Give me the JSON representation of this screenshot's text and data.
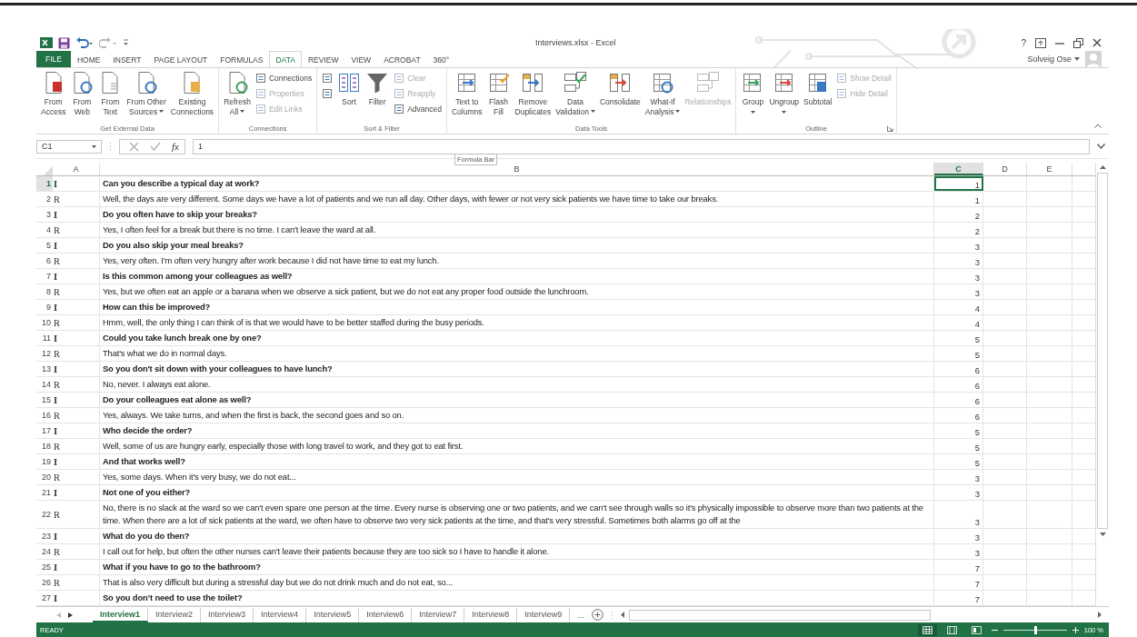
{
  "window": {
    "title": "Interviews.xlsx - Excel",
    "help": "?",
    "user": "Solveig Ose"
  },
  "tabs": [
    {
      "label": "FILE",
      "kind": "file",
      "selected": false
    },
    {
      "label": "HOME",
      "kind": "tab",
      "selected": false
    },
    {
      "label": "INSERT",
      "kind": "tab",
      "selected": false
    },
    {
      "label": "PAGE LAYOUT",
      "kind": "tab",
      "selected": false
    },
    {
      "label": "FORMULAS",
      "kind": "tab",
      "selected": false
    },
    {
      "label": "DATA",
      "kind": "tab",
      "selected": true
    },
    {
      "label": "REVIEW",
      "kind": "tab",
      "selected": false
    },
    {
      "label": "VIEW",
      "kind": "tab",
      "selected": false
    },
    {
      "label": "ACROBAT",
      "kind": "tab",
      "selected": false
    },
    {
      "label": "360°",
      "kind": "tab",
      "selected": false
    }
  ],
  "ribbon": {
    "groups": [
      {
        "label": "Get External Data",
        "items": [
          {
            "kind": "large",
            "lines": [
              "From",
              "Access"
            ],
            "disabled": false
          },
          {
            "kind": "large",
            "lines": [
              "From",
              "Web"
            ],
            "disabled": false
          },
          {
            "kind": "large",
            "lines": [
              "From",
              "Text"
            ],
            "disabled": false
          },
          {
            "kind": "large",
            "lines": [
              "From Other",
              "Sources"
            ],
            "dropdown": true,
            "disabled": false
          },
          {
            "kind": "large",
            "lines": [
              "Existing",
              "Connections"
            ],
            "disabled": false
          }
        ]
      },
      {
        "label": "Connections",
        "items": [
          {
            "kind": "large",
            "lines": [
              "Refresh",
              "All"
            ],
            "dropdown": true,
            "disabled": false
          },
          {
            "kind": "stack",
            "entries": [
              {
                "label": "Connections",
                "disabled": false
              },
              {
                "label": "Properties",
                "disabled": true
              },
              {
                "label": "Edit Links",
                "disabled": true
              }
            ]
          }
        ]
      },
      {
        "label": "Sort & Filter",
        "items": [
          {
            "kind": "stack",
            "entries": [
              {
                "disabled": false
              },
              {
                "disabled": false
              }
            ]
          },
          {
            "kind": "large",
            "lines": [
              "Sort"
            ],
            "disabled": false
          },
          {
            "kind": "large",
            "lines": [
              "Filter"
            ],
            "disabled": false
          },
          {
            "kind": "stack",
            "entries": [
              {
                "label": "Clear",
                "disabled": true
              },
              {
                "label": "Reapply",
                "disabled": true
              },
              {
                "label": "Advanced",
                "disabled": false
              }
            ]
          }
        ]
      },
      {
        "label": "Data Tools",
        "items": [
          {
            "kind": "large",
            "lines": [
              "Text to",
              "Columns"
            ],
            "disabled": false
          },
          {
            "kind": "large",
            "lines": [
              "Flash",
              "Fill"
            ],
            "disabled": false
          },
          {
            "kind": "large",
            "lines": [
              "Remove",
              "Duplicates"
            ],
            "disabled": false
          },
          {
            "kind": "large",
            "lines": [
              "Data",
              "Validation"
            ],
            "dropdown": true,
            "disabled": false
          },
          {
            "kind": "large",
            "lines": [
              "Consolidate"
            ],
            "disabled": false
          },
          {
            "kind": "large",
            "lines": [
              "What-If",
              "Analysis"
            ],
            "dropdown": true,
            "disabled": false
          },
          {
            "kind": "large",
            "lines": [
              "Relationships"
            ],
            "disabled": true
          }
        ]
      },
      {
        "label": "Outline",
        "launcher": true,
        "items": [
          {
            "kind": "large",
            "lines": [
              "Group"
            ],
            "dropdown": true,
            "caret_below": true,
            "disabled": false
          },
          {
            "kind": "large",
            "lines": [
              "Ungroup"
            ],
            "dropdown": true,
            "caret_below": true,
            "disabled": false
          },
          {
            "kind": "large",
            "lines": [
              "Subtotal"
            ],
            "disabled": false
          },
          {
            "kind": "stack",
            "entries": [
              {
                "label": "Show Detail",
                "disabled": true
              },
              {
                "label": "Hide Detail",
                "disabled": true
              }
            ]
          }
        ]
      }
    ]
  },
  "formula_bar": {
    "name_box": "C1",
    "fx": "fx",
    "value": "1",
    "tooltip": "Formula Bar"
  },
  "columns": [
    {
      "label": "A",
      "selected": false
    },
    {
      "label": "B",
      "selected": false
    },
    {
      "label": "C",
      "selected": true
    },
    {
      "label": "D",
      "selected": false
    },
    {
      "label": "E",
      "selected": false
    }
  ],
  "rows": [
    {
      "number": "1",
      "speaker": "I",
      "kind": "question",
      "text": "Can you describe a typical day at work?",
      "value": "1",
      "selected": true
    },
    {
      "number": "2",
      "speaker": "R",
      "kind": "answer",
      "text": "Well, the days are very different. Some days we have a lot of patients and we run all day. Other days, with fewer or not very sick patients we have time to take our breaks.",
      "value": "1",
      "selected": false
    },
    {
      "number": "3",
      "speaker": "I",
      "kind": "question",
      "text": "Do you often have to skip your breaks?",
      "value": "2",
      "selected": false
    },
    {
      "number": "4",
      "speaker": "R",
      "kind": "answer",
      "text": "Yes, I often feel for a break but there is no time. I can't leave the ward at all.",
      "value": "2",
      "selected": false
    },
    {
      "number": "5",
      "speaker": "I",
      "kind": "question",
      "text": "Do you also skip your meal breaks?",
      "value": "3",
      "selected": false
    },
    {
      "number": "6",
      "speaker": "R",
      "kind": "answer",
      "text": "Yes, very often. I'm often very hungry after work because I did not have time to eat my lunch.",
      "value": "3",
      "selected": false
    },
    {
      "number": "7",
      "speaker": "I",
      "kind": "question",
      "text": "Is this common among your colleagues as well?",
      "value": "3",
      "selected": false
    },
    {
      "number": "8",
      "speaker": "R",
      "kind": "answer",
      "text": "Yes, but we often eat an apple or a banana when we observe a sick patient, but we do not eat any proper food outside the lunchroom.",
      "value": "3",
      "selected": false
    },
    {
      "number": "9",
      "speaker": "I",
      "kind": "question",
      "text": "How can this be improved?",
      "value": "4",
      "selected": false
    },
    {
      "number": "10",
      "speaker": "R",
      "kind": "answer",
      "text": "Hmm, well, the only thing I can think of is that we would have to be better staffed during the busy periods.",
      "value": "4",
      "selected": false
    },
    {
      "number": "11",
      "speaker": "I",
      "kind": "question",
      "text": "Could you take lunch break one by one?",
      "value": "5",
      "selected": false
    },
    {
      "number": "12",
      "speaker": "R",
      "kind": "answer",
      "text": "That's what we do in normal days.",
      "value": "5",
      "selected": false
    },
    {
      "number": "13",
      "speaker": "I",
      "kind": "question",
      "text": "So you don't sit down with your colleagues to have lunch?",
      "value": "6",
      "selected": false
    },
    {
      "number": "14",
      "speaker": "R",
      "kind": "answer",
      "text": "No, never. I always eat alone.",
      "value": "6",
      "selected": false
    },
    {
      "number": "15",
      "speaker": "I",
      "kind": "question",
      "text": "Do your colleagues eat alone as well?",
      "value": "6",
      "selected": false
    },
    {
      "number": "16",
      "speaker": "R",
      "kind": "answer",
      "text": "Yes, always. We take turns, and when the first is back, the second goes and so on.",
      "value": "6",
      "selected": false
    },
    {
      "number": "17",
      "speaker": "I",
      "kind": "question",
      "text": "Who decide the order?",
      "value": "5",
      "selected": false
    },
    {
      "number": "18",
      "speaker": "R",
      "kind": "answer",
      "text": "Well, some of us are hungry early, especially those with long travel to work, and they got to eat first.",
      "value": "5",
      "selected": false
    },
    {
      "number": "19",
      "speaker": "I",
      "kind": "question",
      "text": "And that works well?",
      "value": "5",
      "selected": false
    },
    {
      "number": "20",
      "speaker": "R",
      "kind": "answer",
      "text": "Yes, some days. When it's very busy, we do not eat...",
      "value": "3",
      "selected": false
    },
    {
      "number": "21",
      "speaker": "I",
      "kind": "question",
      "text": "Not one of you either?",
      "value": "3",
      "selected": false
    },
    {
      "number": "22",
      "speaker": "R",
      "kind": "answer",
      "text": "No, there is no slack at the ward so we can't even spare one person at the time. Every nurse is observing one or two patients, and we can't see through walls so it's physically impossible to observe more than two patients at the time. When there are a lot of sick patients at the ward, we often have to observe two very sick patients at the time, and that's very stressful. Sometimes both alarms go off at the",
      "value": "3",
      "selected": false
    },
    {
      "number": "23",
      "speaker": "I",
      "kind": "question",
      "text": "What do you do then?",
      "value": "3",
      "selected": false
    },
    {
      "number": "24",
      "speaker": "R",
      "kind": "answer",
      "text": "I call out for help, but often the other nurses can't leave their patients because they are too sick so I have to handle it alone.",
      "value": "3",
      "selected": false
    },
    {
      "number": "25",
      "speaker": "I",
      "kind": "question",
      "text": "What if you have to go to the bathroom?",
      "value": "7",
      "selected": false
    },
    {
      "number": "26",
      "speaker": "R",
      "kind": "answer",
      "text": "That is also very difficult but during a stressful day but we do not drink much and do not eat, so...",
      "value": "7",
      "selected": false
    },
    {
      "number": "27",
      "speaker": "I",
      "kind": "question",
      "text": "So you don’t need to use the toilet?",
      "value": "7",
      "selected": false
    }
  ],
  "sheets": {
    "tabs": [
      {
        "label": "Interview1",
        "selected": true
      },
      {
        "label": "Interview2",
        "selected": false
      },
      {
        "label": "Interview3",
        "selected": false
      },
      {
        "label": "Interview4",
        "selected": false
      },
      {
        "label": "Interview5",
        "selected": false
      },
      {
        "label": "Interview6",
        "selected": false
      },
      {
        "label": "Interview7",
        "selected": false
      },
      {
        "label": "Interview8",
        "selected": false
      },
      {
        "label": "Interview9",
        "selected": false
      }
    ],
    "more": "..."
  },
  "status_bar": {
    "mode": "READY",
    "views": [
      {
        "selected": true
      },
      {
        "selected": false
      },
      {
        "selected": false
      }
    ],
    "zoom": {
      "level": 0.5,
      "reading": "100 %"
    }
  }
}
